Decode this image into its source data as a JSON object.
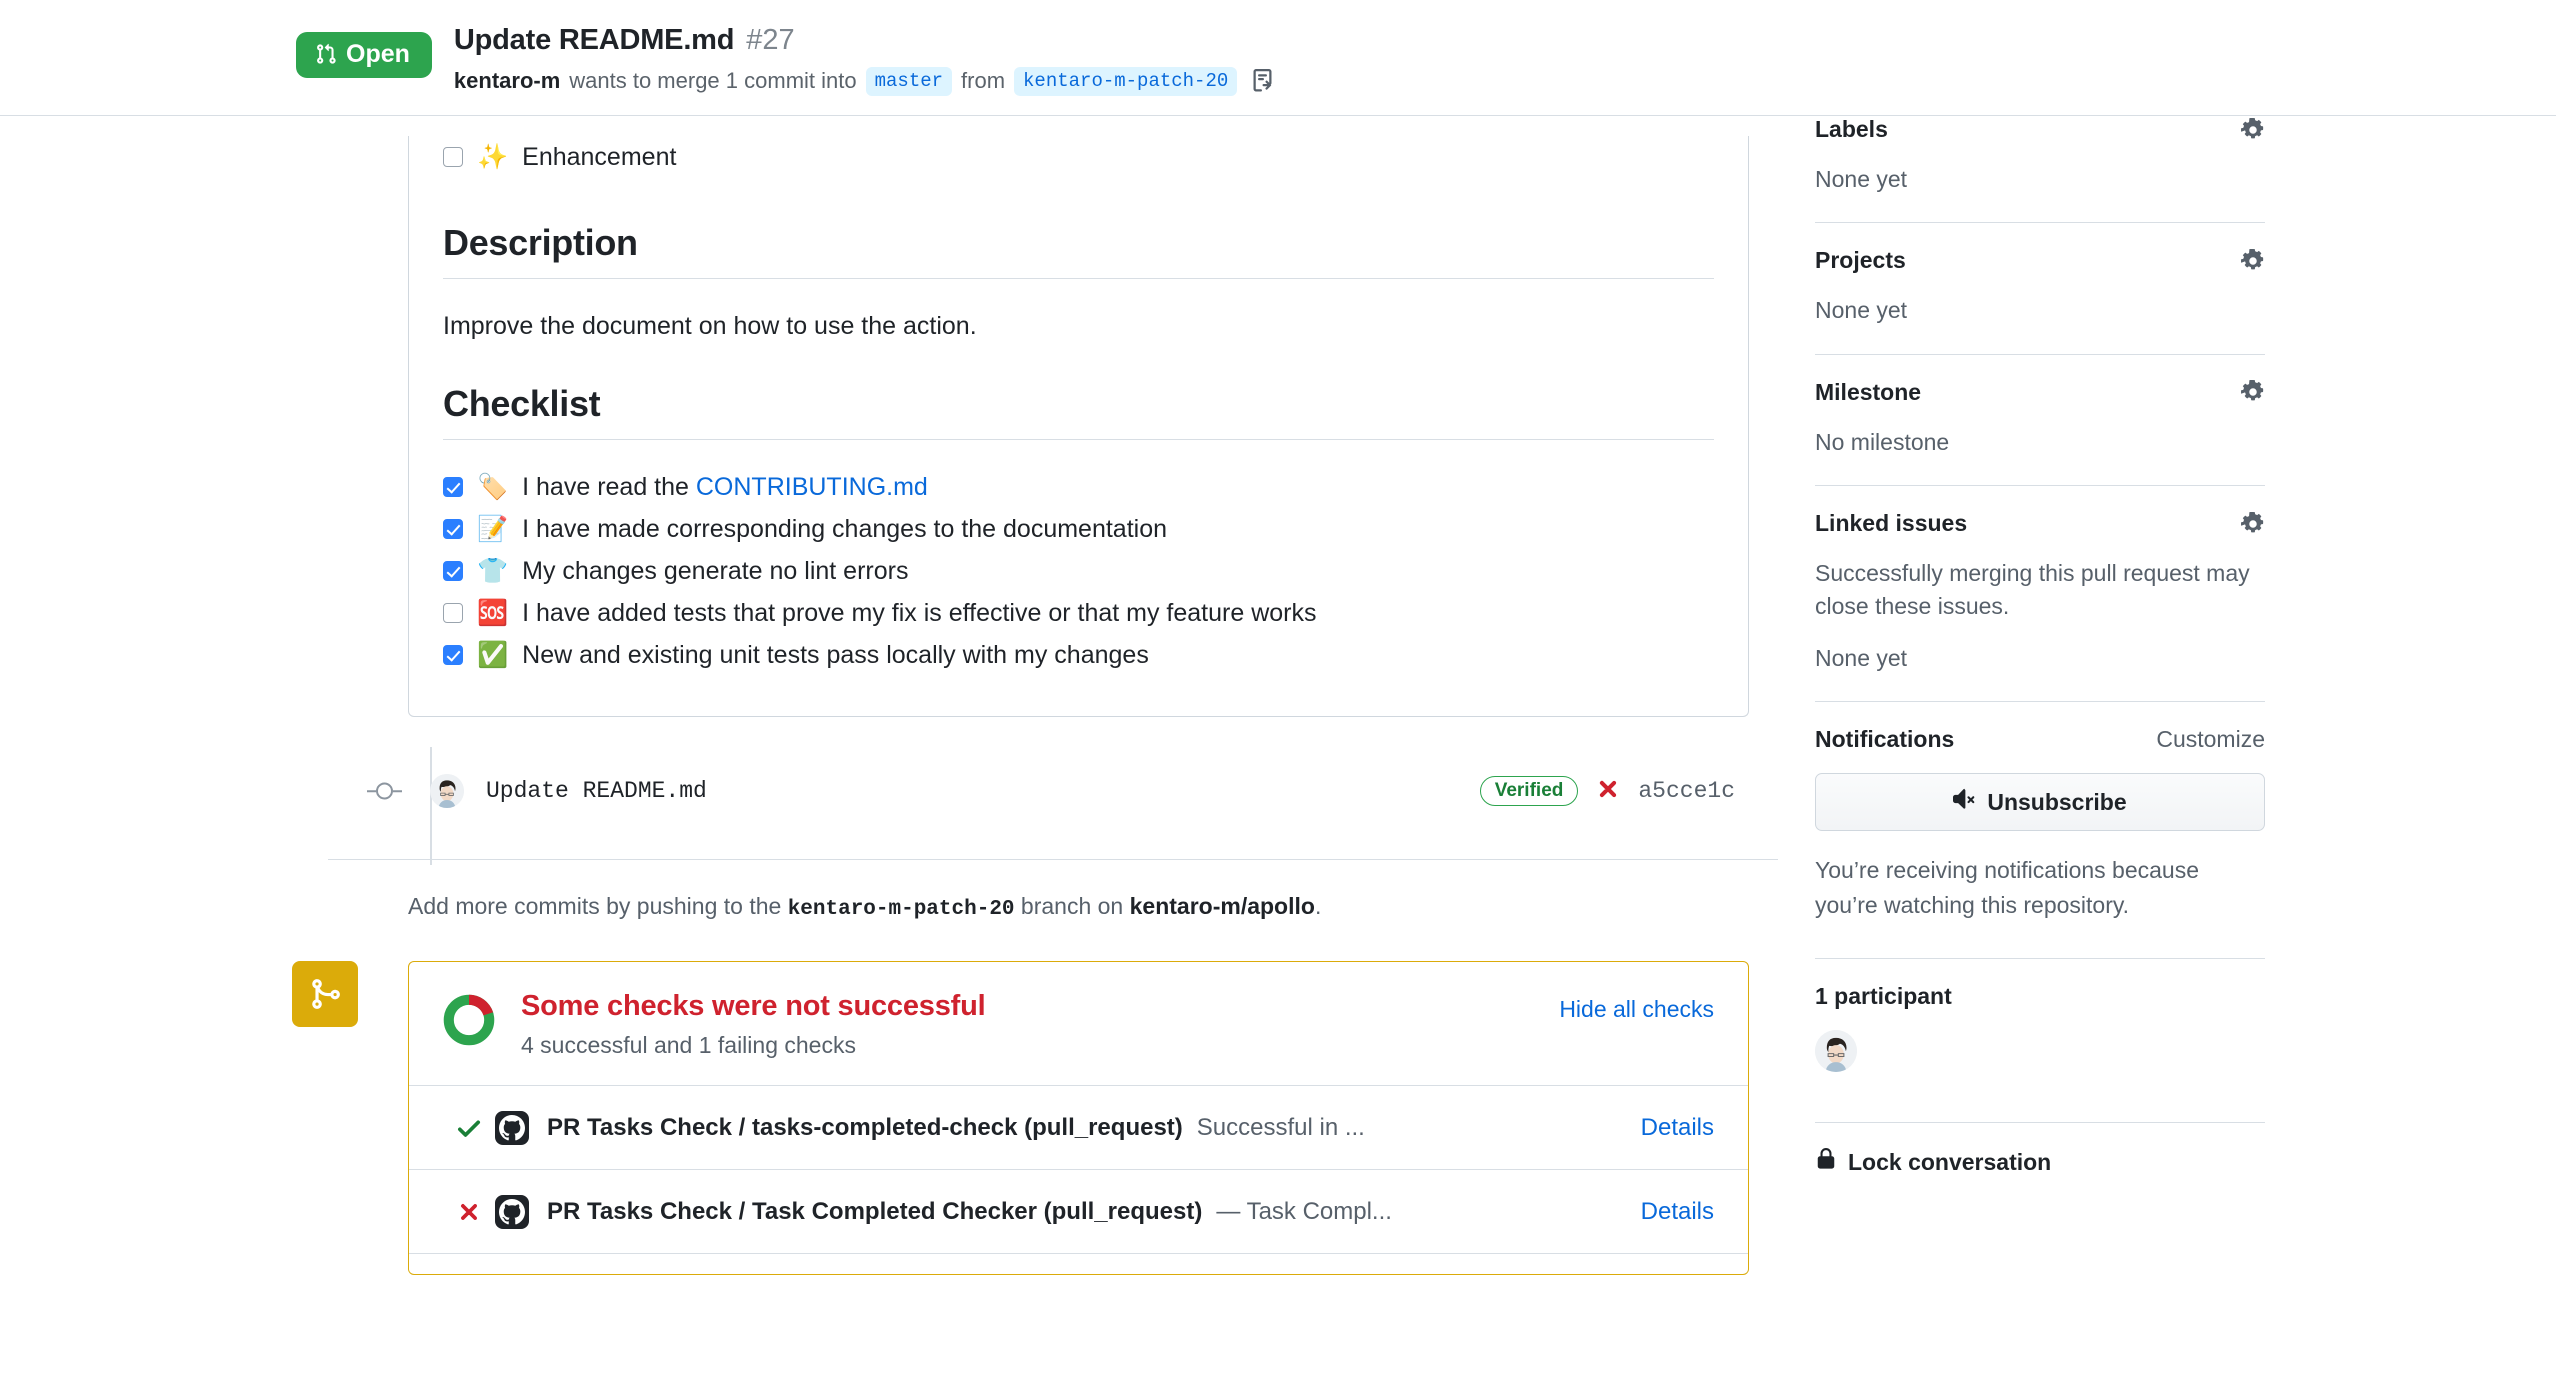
{
  "header": {
    "state_label": "Open",
    "state_color": "#2da44e",
    "title": "Update README.md",
    "number": "#27",
    "author": "kentaro-m",
    "action_text": "wants to merge 1 commit into",
    "base_branch": "master",
    "from_text": "from",
    "head_branch": "kentaro-m-patch-20",
    "copy_icon": "copy-branch-icon"
  },
  "body": {
    "top_task": {
      "emoji": "✨",
      "label": "Enhancement",
      "checked": false
    },
    "description_heading": "Description",
    "description_text": "Improve the document on how to use the action.",
    "checklist_heading": "Checklist",
    "checklist": [
      {
        "checked": true,
        "emoji": "🏷️",
        "pre": "I have read the ",
        "link": "CONTRIBUTING.md",
        "post": ""
      },
      {
        "checked": true,
        "emoji": "📝",
        "pre": "I have made corresponding changes to the documentation",
        "link": "",
        "post": ""
      },
      {
        "checked": true,
        "emoji": "👕",
        "pre": "My changes generate no lint errors",
        "link": "",
        "post": ""
      },
      {
        "checked": false,
        "emoji": "🆘",
        "pre": "I have added tests that prove my fix is effective or that my feature works",
        "link": "",
        "post": ""
      },
      {
        "checked": true,
        "emoji": "✅",
        "pre": "New and existing unit tests pass locally with my changes",
        "link": "",
        "post": ""
      }
    ]
  },
  "commit": {
    "avatar": "user-avatar",
    "message": "Update README.md",
    "verified_label": "Verified",
    "status_icon": "x-failure-icon",
    "sha": "a5cce1c"
  },
  "push_note": {
    "prefix": "Add more commits by pushing to the ",
    "branch": "kentaro-m-patch-20",
    "middle": " branch on ",
    "repo": "kentaro-m/apollo",
    "suffix": "."
  },
  "checks": {
    "badge_icon": "git-merge-icon",
    "title": "Some checks were not successful",
    "subtitle": "4 successful and 1 failing checks",
    "hide_all_label": "Hide all checks",
    "donut": {
      "success": 4,
      "failure": 1,
      "success_color": "#2da44e",
      "failure_color": "#cf222e"
    },
    "rows": [
      {
        "status": "success",
        "status_icon": "check-icon",
        "provider_icon": "github-icon",
        "name": "PR Tasks Check / tasks-completed-check (pull_request)",
        "desc": "Successful in ...",
        "details_label": "Details"
      },
      {
        "status": "failure",
        "status_icon": "x-icon",
        "provider_icon": "github-icon",
        "name": "PR Tasks Check / Task Completed Checker (pull_request)",
        "desc": "— Task Compl...",
        "details_label": "Details"
      }
    ]
  },
  "sidebar": {
    "labels": {
      "heading": "Labels",
      "value": "None yet",
      "gear": "gear-icon"
    },
    "projects": {
      "heading": "Projects",
      "value": "None yet",
      "gear": "gear-icon"
    },
    "milestone": {
      "heading": "Milestone",
      "value": "No milestone",
      "gear": "gear-icon"
    },
    "linked_issues": {
      "heading": "Linked issues",
      "gear": "gear-icon",
      "help": "Successfully merging this pull request may close these issues.",
      "value": "None yet"
    },
    "notifications": {
      "heading": "Notifications",
      "customize_label": "Customize",
      "button_label": "Unsubscribe",
      "button_icon": "mute-icon",
      "note": "You’re receiving notifications because you’re watching this repository."
    },
    "participants": {
      "heading": "1 participant",
      "avatar": "user-avatar"
    },
    "lock": {
      "label": "Lock conversation",
      "icon": "lock-icon"
    }
  }
}
